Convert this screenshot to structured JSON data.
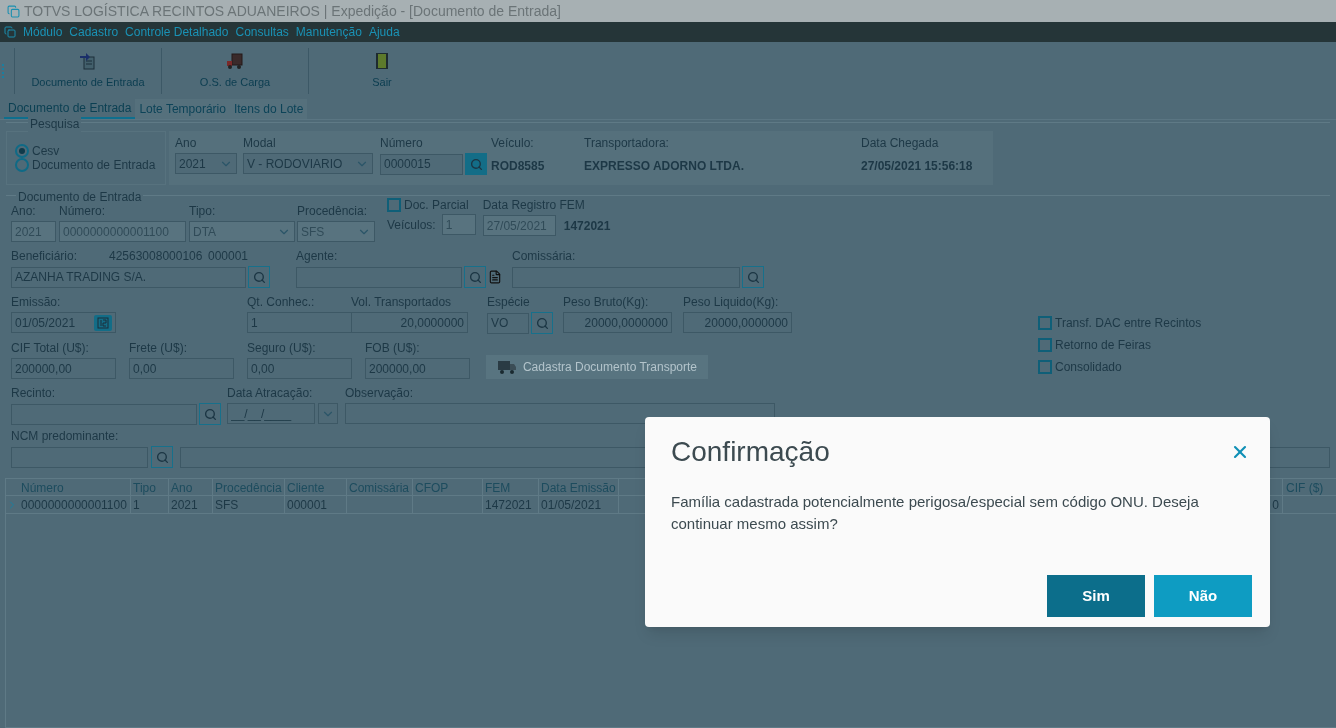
{
  "window": {
    "title": "TOTVS LOGÍSTICA RECINTOS ADUANEIROS | Expedição - [Documento de Entrada]"
  },
  "menu": [
    "Módulo",
    "Cadastro",
    "Controle Detalhado",
    "Consultas",
    "Manutenção",
    "Ajuda"
  ],
  "toolbar": [
    {
      "label": "Documento de Entrada",
      "kind": "document"
    },
    {
      "label": "O.S. de Carga",
      "kind": "cargo"
    },
    {
      "label": "Sair",
      "kind": "exit"
    }
  ],
  "tabs": [
    {
      "label": "Documento de Entrada",
      "selected": true
    },
    {
      "label": "Lote Temporário",
      "selected": false
    },
    {
      "label": "Itens do Lote",
      "selected": false
    }
  ],
  "pesquisa": {
    "title": "Pesquisa",
    "options": [
      {
        "label": "Cesv",
        "selected": true
      },
      {
        "label": "Documento de Entrada",
        "selected": false
      }
    ],
    "ano": {
      "label": "Ano",
      "value": "2021"
    },
    "modal": {
      "label": "Modal",
      "value": "V - RODOVIARIO"
    },
    "numero": {
      "label": "Número",
      "value": "0000015"
    },
    "veiculo": {
      "label": "Veículo:",
      "value": "ROD8585"
    },
    "transportadora": {
      "label": "Transportadora:",
      "value": "EXPRESSO ADORNO LTDA."
    },
    "data_chegada": {
      "label": "Data Chegada",
      "value": "27/05/2021 15:56:18"
    }
  },
  "documento": {
    "title": "Documento de Entrada",
    "ano": {
      "label": "Ano:",
      "value": "2021",
      "disabled": true
    },
    "numero": {
      "label": "Número:",
      "value": "0000000000001100",
      "disabled": true
    },
    "tipo": {
      "label": "Tipo:",
      "value": "DTA",
      "disabled": true
    },
    "procedencia": {
      "label": "Procedência:",
      "value": "SFS",
      "disabled": true
    },
    "doc_parcial": {
      "label": "Doc. Parcial",
      "checked": false
    },
    "veiculos": {
      "label": "Veículos:",
      "value": "1",
      "disabled": true
    },
    "data_registro_fem": {
      "label": "Data Registro FEM",
      "value": "27/05/2021",
      "disabled": true
    },
    "fem": "1472021",
    "beneficiario": {
      "label": "Beneficiário:",
      "cnpj": "42563008000106",
      "code": "000001",
      "value": "AZANHA TRADING S/A."
    },
    "agente": {
      "label": "Agente:"
    },
    "comissaria": {
      "label": "Comissária:"
    },
    "emissao": {
      "label": "Emissão:",
      "value": "01/05/2021"
    },
    "qt_conhec": {
      "label": "Qt. Conhec.:",
      "value": "1"
    },
    "vol_transportados": {
      "label": "Vol. Transportados",
      "value": "20,0000000"
    },
    "especie": {
      "label": "Espécie",
      "value": "VO"
    },
    "peso_bruto": {
      "label": "Peso Bruto(Kg):",
      "value": "20000,0000000"
    },
    "peso_liquido": {
      "label": "Peso Liquido(Kg):",
      "value": "20000,0000000"
    },
    "cif_total": {
      "label": "CIF Total (U$):",
      "value": "200000,00"
    },
    "frete": {
      "label": "Frete (U$):",
      "value": "0,00"
    },
    "seguro": {
      "label": "Seguro (U$):",
      "value": "0,00"
    },
    "fob": {
      "label": "FOB (U$):",
      "value": "200000,00"
    },
    "cadastra_button": {
      "label": "Cadastra Documento Transporte",
      "disabled": true
    },
    "recinto": {
      "label": "Recinto:"
    },
    "data_atracacao": {
      "label": "Data Atracação:",
      "placeholder": "__/__/____"
    },
    "observacao": {
      "label": "Observação:"
    },
    "ncm": {
      "label": "NCM predominante:"
    },
    "options": [
      {
        "label": "Transf. DAC entre Recintos",
        "checked": false
      },
      {
        "label": "Retorno de Feiras",
        "checked": false
      },
      {
        "label": "Consolidado",
        "checked": false
      }
    ]
  },
  "grid": {
    "columns": [
      "Número",
      "Tipo",
      "Ano",
      "Procedência",
      "Cliente",
      "Comissária",
      "CFOP",
      "FEM",
      "Data Emissão"
    ],
    "last_column": "CIF ($)",
    "rows": [
      {
        "current": true,
        "cells": [
          "0000000000001100",
          "1",
          "2021",
          "SFS",
          "000001",
          "",
          "",
          "1472021",
          "01/05/2021"
        ],
        "cut_cell": "0"
      }
    ]
  },
  "dialog": {
    "title": "Confirmação",
    "message": "Família cadastrada potencialmente perigosa/especial sem código ONU. Deseja continuar mesmo assim?",
    "buttons": [
      {
        "label": "Sim",
        "kind": "primary"
      },
      {
        "label": "Não",
        "kind": "secondary"
      }
    ]
  }
}
